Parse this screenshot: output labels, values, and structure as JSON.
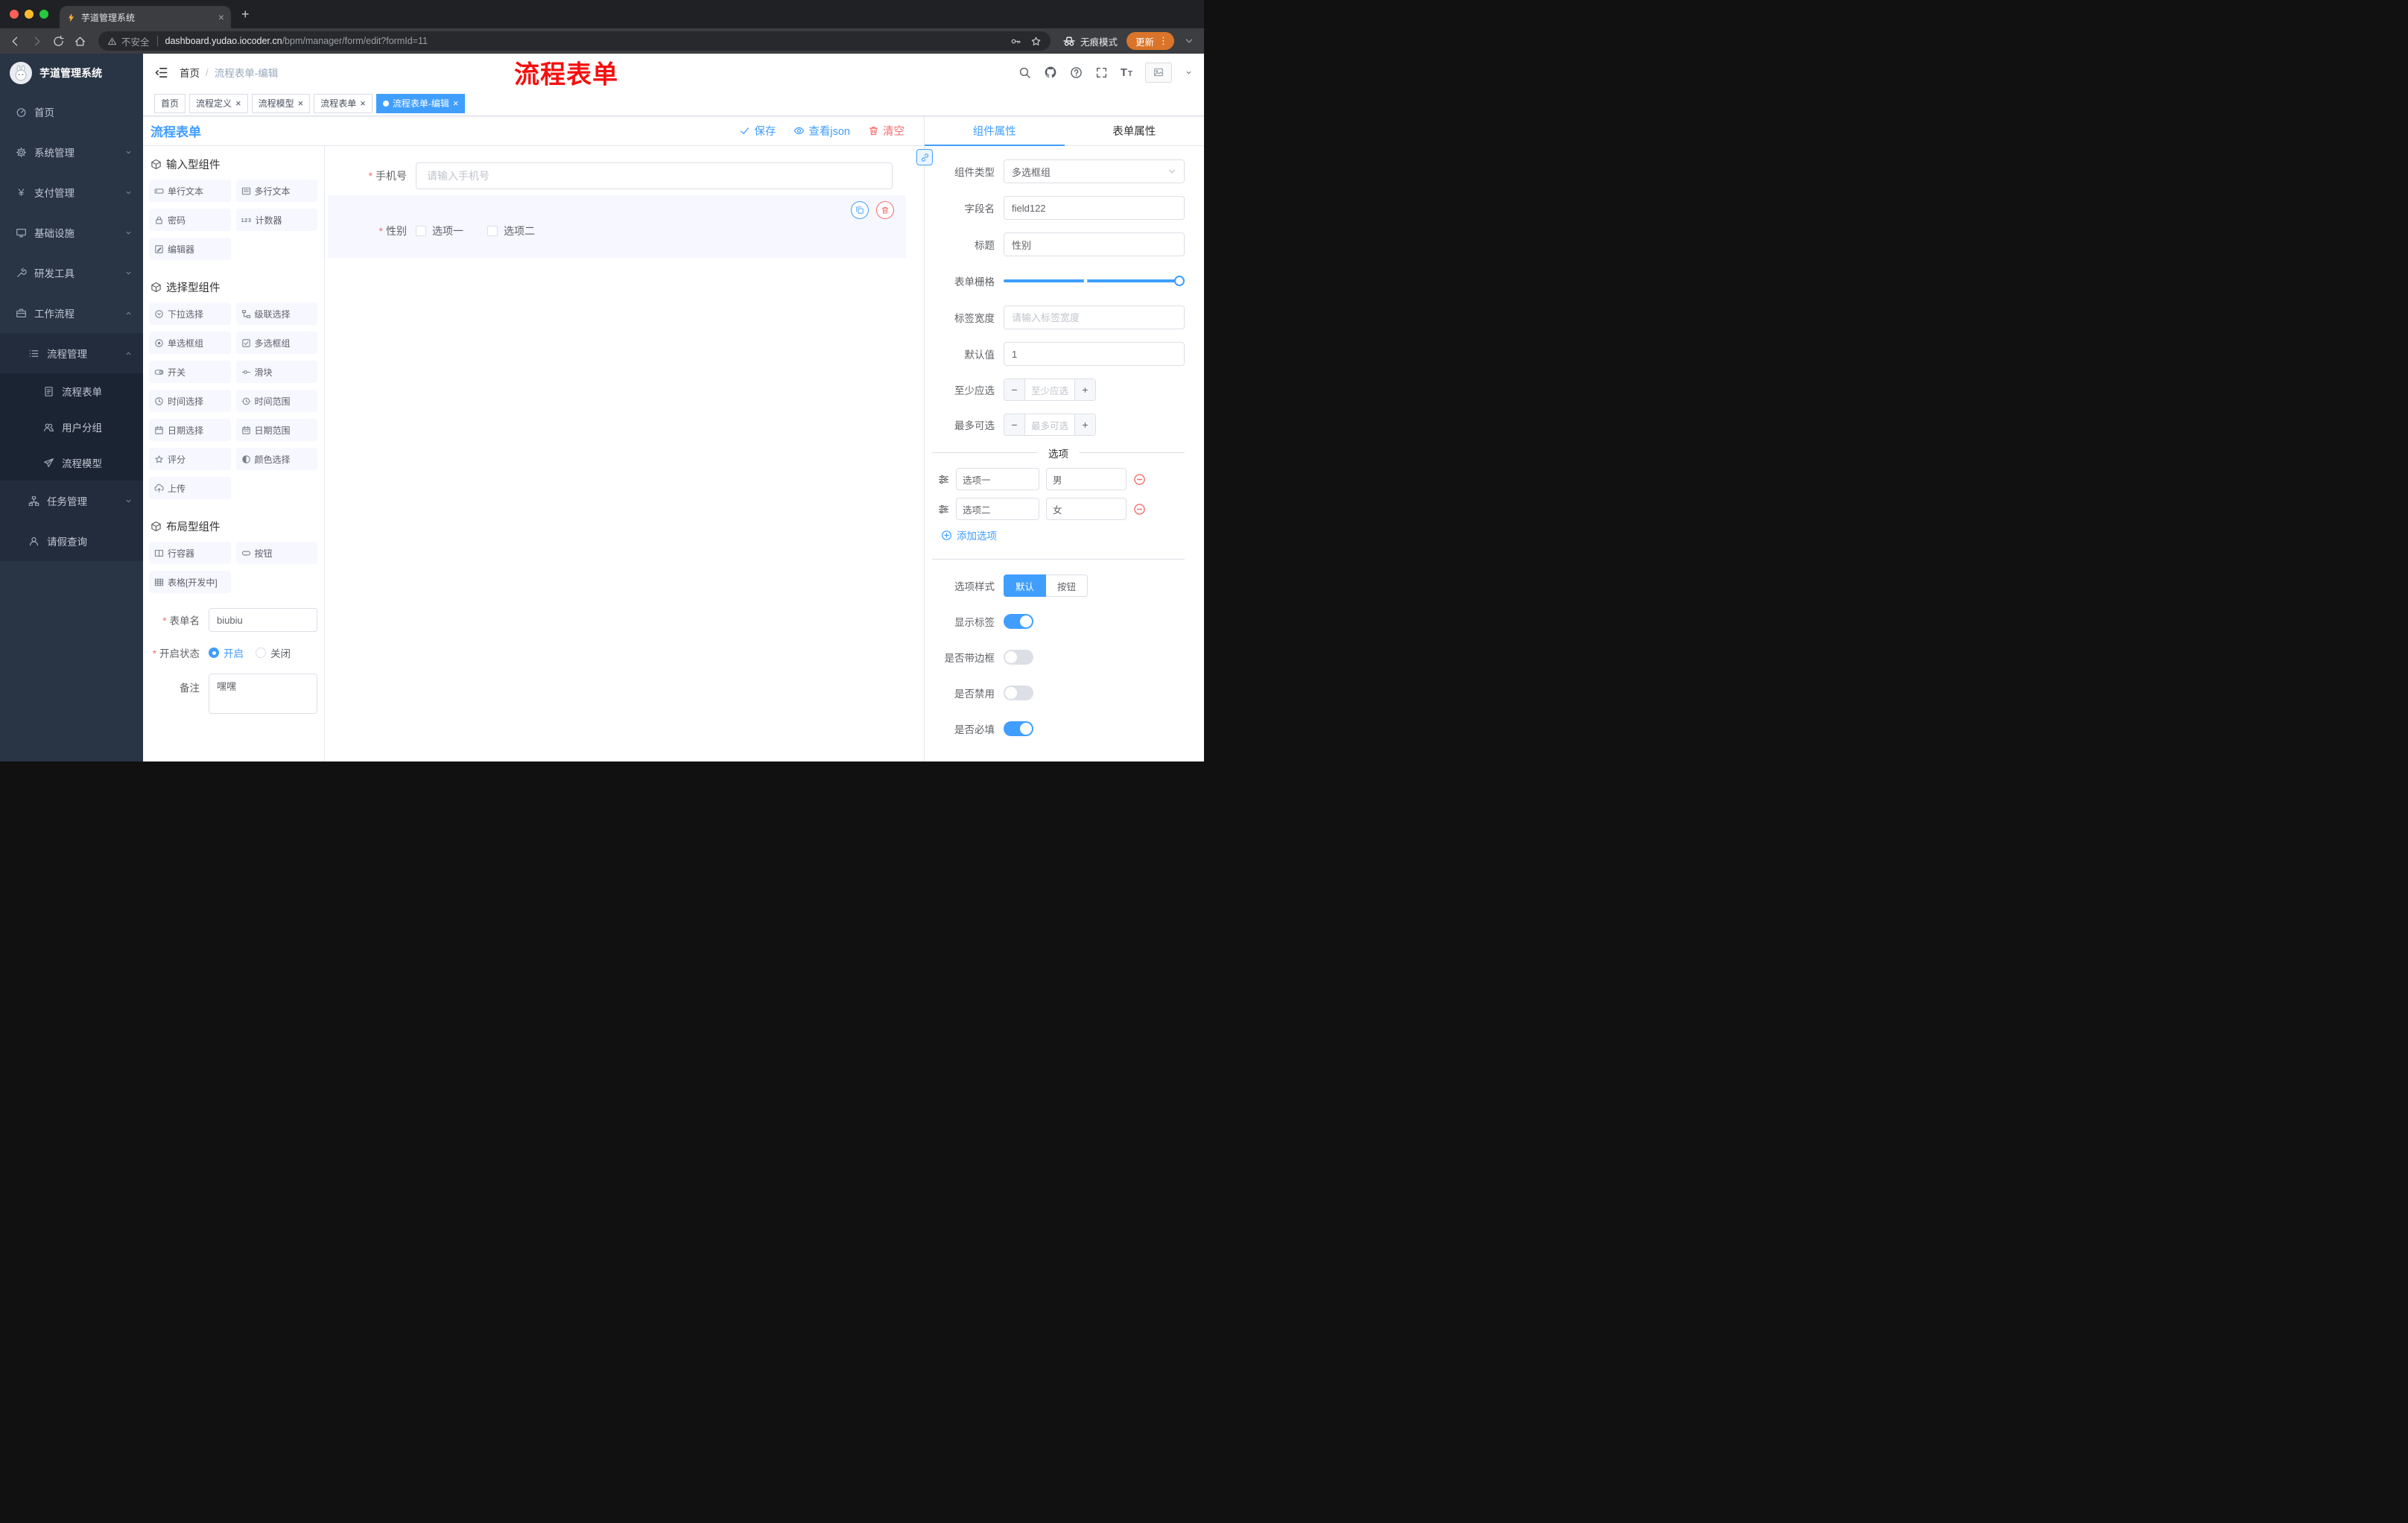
{
  "browser": {
    "tab_title": "芋道管理系统",
    "security_label": "不安全",
    "url_domain": "dashboard.yudao.iocoder.cn",
    "url_path": "/bpm/manager/form/edit?formId=11",
    "incognito_label": "无痕模式",
    "update_label": "更新"
  },
  "header": {
    "breadcrumb_home": "首页",
    "breadcrumb_current": "流程表单-编辑",
    "annotation": "流程表单"
  },
  "sidebar": {
    "logo_title": "芋道管理系统",
    "items": [
      {
        "label": "首页"
      },
      {
        "label": "系统管理"
      },
      {
        "label": "支付管理"
      },
      {
        "label": "基础设施"
      },
      {
        "label": "研发工具"
      },
      {
        "label": "工作流程"
      }
    ],
    "workflow": {
      "process_mgmt": "流程管理",
      "process_children": [
        {
          "label": "流程表单"
        },
        {
          "label": "用户分组"
        },
        {
          "label": "流程模型"
        }
      ],
      "task_mgmt": "任务管理",
      "leave_query": "请假查询"
    }
  },
  "tags": [
    {
      "label": "首页"
    },
    {
      "label": "流程定义"
    },
    {
      "label": "流程模型"
    },
    {
      "label": "流程表单"
    },
    {
      "label": "流程表单-编辑"
    }
  ],
  "designer": {
    "panel_title": "流程表单",
    "save_label": "保存",
    "view_json_label": "查看json",
    "clear_label": "清空",
    "sections": {
      "input": {
        "title": "输入型组件",
        "items": [
          "单行文本",
          "多行文本",
          "密码",
          "计数器",
          "编辑器"
        ]
      },
      "select": {
        "title": "选择型组件",
        "items": [
          "下拉选择",
          "级联选择",
          "单选框组",
          "多选框组",
          "开关",
          "滑块",
          "时间选择",
          "时间范围",
          "日期选择",
          "日期范围",
          "评分",
          "颜色选择",
          "上传"
        ]
      },
      "layout": {
        "title": "布局型组件",
        "items": [
          "行容器",
          "按钮",
          "表格[开发中]"
        ]
      }
    },
    "form": {
      "name_label": "表单名",
      "name_value": "biubiu",
      "status_label": "开启状态",
      "status_on": "开启",
      "status_off": "关闭",
      "remark_label": "备注",
      "remark_value": "嘿嘿"
    }
  },
  "canvas": {
    "phone_label": "手机号",
    "phone_placeholder": "请输入手机号",
    "gender_label": "性别",
    "gender_option1": "选项一",
    "gender_option2": "选项二"
  },
  "props": {
    "tab_component": "组件属性",
    "tab_form": "表单属性",
    "type_label": "组件类型",
    "type_value": "多选框组",
    "field_label": "字段名",
    "field_value": "field122",
    "title_label": "标题",
    "title_value": "性别",
    "grid_label": "表单栅格",
    "width_label": "标签宽度",
    "width_placeholder": "请输入标签宽度",
    "default_label": "默认值",
    "default_value": "1",
    "min_label": "至少应选",
    "min_placeholder": "至少应选",
    "max_label": "最多可选",
    "max_placeholder": "最多可选",
    "options_title": "选项",
    "options": [
      {
        "label": "选项一",
        "value": "男"
      },
      {
        "label": "选项二",
        "value": "女"
      }
    ],
    "add_option_label": "添加选项",
    "style_label": "选项样式",
    "style_default": "默认",
    "style_button": "按钮",
    "show_label": "显示标签",
    "border_label": "是否带边框",
    "disabled_label": "是否禁用",
    "required_label": "是否必填"
  },
  "colors": {
    "accent": "#409eff",
    "danger": "#f56c6c",
    "annotation": "#f70f0f",
    "update_button": "#d9742a",
    "sidebar_bg": "#293445"
  }
}
